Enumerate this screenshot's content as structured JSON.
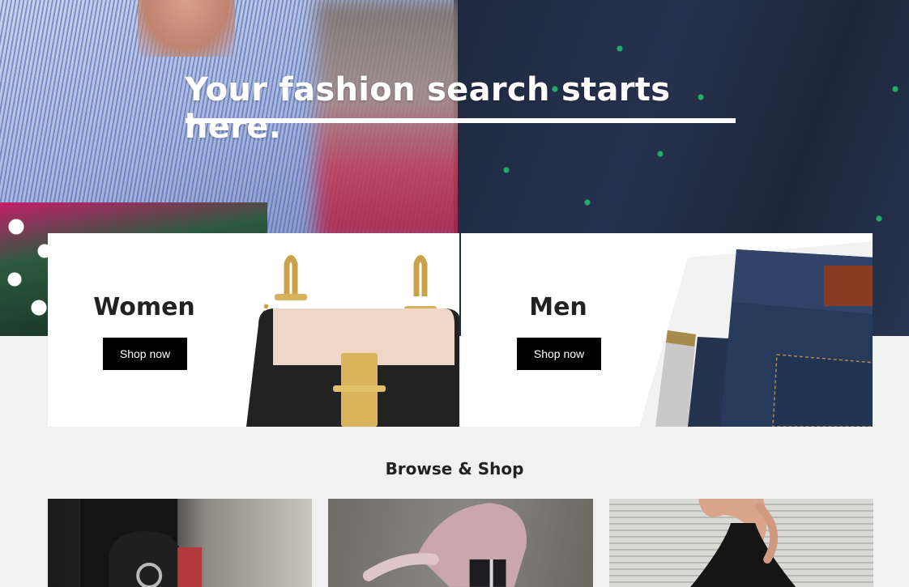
{
  "hero": {
    "title": "Your fashion search starts here."
  },
  "categories": [
    {
      "name": "Women",
      "button": "Shop now",
      "image": "handbag-image"
    },
    {
      "name": "Men",
      "button": "Shop now",
      "image": "jeans-image"
    }
  ],
  "browse": {
    "title": "Browse & Shop",
    "tiles": [
      {
        "image": "street-style-handbag-image"
      },
      {
        "image": "street-style-pink-jacket-image"
      },
      {
        "image": "black-dress-image"
      }
    ]
  },
  "colors": {
    "background": "#f1f1f1",
    "card": "#ffffff",
    "button": "#000000",
    "button_text": "#ffffff",
    "heading": "#222222"
  }
}
